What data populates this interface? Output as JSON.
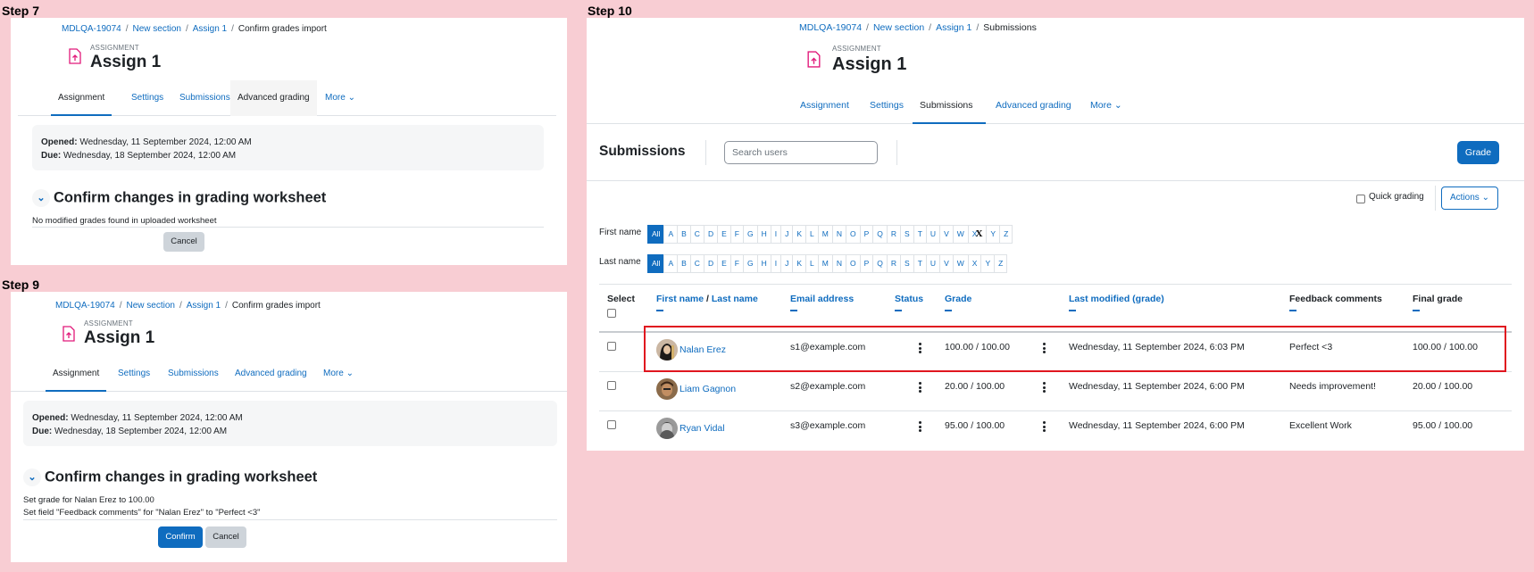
{
  "steps": {
    "s7": "Step 7",
    "s9": "Step 9",
    "s10": "Step 10"
  },
  "breadcrumb": {
    "course": "MDLQA-19074",
    "section": "New section",
    "assign": "Assign 1",
    "confirm_import": "Confirm grades import",
    "submissions": "Submissions"
  },
  "assignment": {
    "kind": "ASSIGNMENT",
    "title": "Assign 1"
  },
  "tabs": {
    "assignment": "Assignment",
    "settings": "Settings",
    "submissions": "Submissions",
    "advanced": "Advanced grading",
    "more": "More"
  },
  "dates": {
    "opened_label": "Opened:",
    "opened_value": " Wednesday, 11 September 2024, 12:00 AM",
    "due_label": "Due:",
    "due_value": " Wednesday, 18 September 2024, 12:00 AM"
  },
  "step7": {
    "heading": "Confirm changes in grading worksheet",
    "message": "No modified grades found in uploaded worksheet",
    "cancel": "Cancel"
  },
  "step9": {
    "heading": "Confirm changes in grading worksheet",
    "line1": "Set grade for Nalan Erez to 100.00",
    "line2": "Set field \"Feedback comments\" for \"Nalan Erez\" to \"Perfect <3\"",
    "confirm": "Confirm",
    "cancel": "Cancel"
  },
  "step10": {
    "heading": "Submissions",
    "search_placeholder": "Search users",
    "grade_button": "Grade",
    "quick_grading": "Quick grading",
    "actions": "Actions",
    "first_name_label": "First name",
    "last_name_label": "Last name",
    "letters_all": "All",
    "letters": [
      "A",
      "B",
      "C",
      "D",
      "E",
      "F",
      "G",
      "H",
      "I",
      "J",
      "K",
      "L",
      "M",
      "N",
      "O",
      "P",
      "Q",
      "R",
      "S",
      "T",
      "U",
      "V",
      "W",
      "X",
      "Y",
      "Z"
    ],
    "columns": {
      "select": "Select",
      "first_name": "First name",
      "name_sep": " / ",
      "last_name": "Last name",
      "email": "Email address",
      "status": "Status",
      "grade": "Grade",
      "last_modified": "Last modified (grade)",
      "feedback": "Feedback comments",
      "final_grade": "Final grade"
    },
    "rows": [
      {
        "name": "Nalan Erez",
        "email": "s1@example.com",
        "grade": "100.00 / 100.00",
        "modified": "Wednesday, 11 September 2024, 6:03 PM",
        "feedback": "Perfect <3",
        "final": "100.00 / 100.00"
      },
      {
        "name": "Liam Gagnon",
        "email": "s2@example.com",
        "grade": "20.00 / 100.00",
        "modified": "Wednesday, 11 September 2024, 6:00 PM",
        "feedback": "Needs improvement!",
        "final": "20.00 / 100.00"
      },
      {
        "name": "Ryan Vidal",
        "email": "s3@example.com",
        "grade": "95.00 / 100.00",
        "modified": "Wednesday, 11 September 2024, 6:00 PM",
        "feedback": "Excellent Work",
        "final": "95.00 / 100.00"
      }
    ],
    "highlight_color": "#e0161f"
  }
}
